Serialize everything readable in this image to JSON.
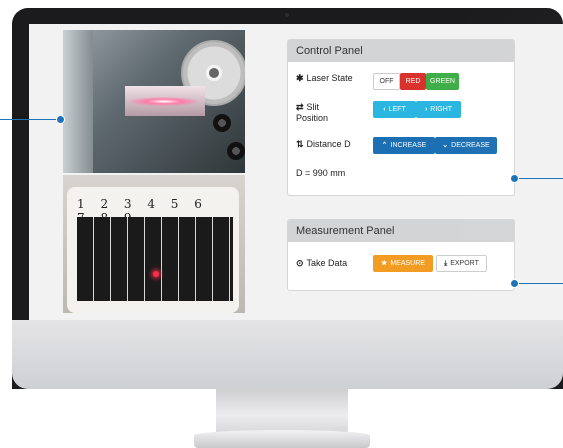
{
  "control_panel": {
    "title": "Control Panel",
    "laser": {
      "label": "Laser State",
      "icon": "asterisk-icon",
      "off": "OFF",
      "red": "RED",
      "green": "GREEN"
    },
    "slit": {
      "label_line1": "Slit",
      "label_line2": "Position",
      "icon": "swap-arrows-icon",
      "left": "LEFT",
      "right": "RIGHT"
    },
    "distance": {
      "label": "Distance D",
      "icon": "sort-arrows-icon",
      "increase": "INCREASE",
      "decrease": "DECREASE"
    },
    "readout": "D = 990 mm"
  },
  "measurement_panel": {
    "title": "Measurement Panel",
    "take_data": {
      "label": "Take Data",
      "icon": "record-circle-icon"
    },
    "measure": "MEASURE",
    "export": "EXPORT"
  },
  "photos": {
    "grating_digits": "1 2 3 4 5 6 7 8 9"
  },
  "colors": {
    "red_button": "#d9322c",
    "green_button": "#3fae49",
    "cyan_button": "#2ab6e0",
    "blue_button": "#1c6fb3",
    "orange_button": "#f39c24",
    "callout": "#1f73b7",
    "panel_header": "#d3d4d6"
  }
}
